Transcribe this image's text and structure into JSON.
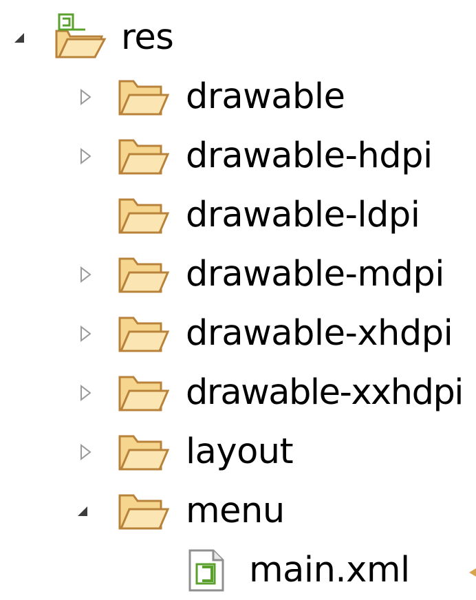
{
  "tree": {
    "root": {
      "label": "res",
      "expanded": true,
      "icon": "android-resource-folder-icon"
    },
    "children": [
      {
        "label": "drawable",
        "expanded": false,
        "has_children": true,
        "icon": "folder-open-icon"
      },
      {
        "label": "drawable-hdpi",
        "expanded": false,
        "has_children": true,
        "icon": "folder-open-icon"
      },
      {
        "label": "drawable-ldpi",
        "expanded": false,
        "has_children": false,
        "icon": "folder-open-icon"
      },
      {
        "label": "drawable-mdpi",
        "expanded": false,
        "has_children": true,
        "icon": "folder-open-icon"
      },
      {
        "label": "drawable-xhdpi",
        "expanded": false,
        "has_children": true,
        "icon": "folder-open-icon"
      },
      {
        "label": "drawable-xxhdpi",
        "expanded": false,
        "has_children": true,
        "icon": "folder-open-icon"
      },
      {
        "label": "layout",
        "expanded": false,
        "has_children": true,
        "icon": "folder-open-icon"
      },
      {
        "label": "menu",
        "expanded": true,
        "has_children": true,
        "icon": "folder-open-icon",
        "children": [
          {
            "label": "main.xml",
            "icon": "android-xml-file-icon"
          }
        ]
      }
    ]
  },
  "colors": {
    "folder_fill": "#f6d58f",
    "folder_stroke": "#b8823a",
    "twisty_collapsed": "#9a9a9a",
    "twisty_expanded": "#3c3c3c",
    "android_green": "#5aa02c"
  }
}
